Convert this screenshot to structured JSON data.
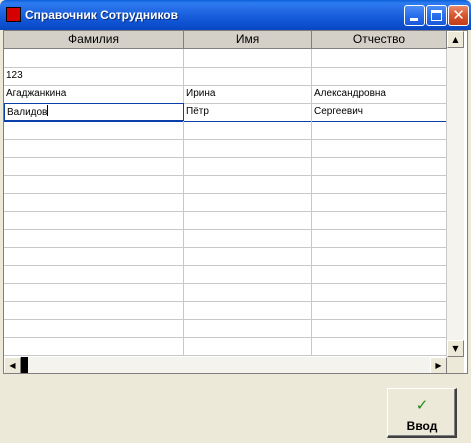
{
  "window": {
    "title": "Справочник Сотрудников",
    "close_glyph": "✕"
  },
  "grid": {
    "columns": [
      "Фамилия",
      "Имя",
      "Отчество"
    ],
    "rows": [
      [
        "",
        "",
        ""
      ],
      [
        "123",
        "",
        ""
      ],
      [
        "Агаджанкина",
        "Ирина",
        "Александровна"
      ],
      [
        "Валидов",
        "Пётр",
        "Сергеевич"
      ],
      [
        "",
        "",
        ""
      ],
      [
        "",
        "",
        ""
      ],
      [
        "",
        "",
        ""
      ],
      [
        "",
        "",
        ""
      ],
      [
        "",
        "",
        ""
      ],
      [
        "",
        "",
        ""
      ],
      [
        "",
        "",
        ""
      ],
      [
        "",
        "",
        ""
      ],
      [
        "",
        "",
        ""
      ],
      [
        "",
        "",
        ""
      ],
      [
        "",
        "",
        ""
      ],
      [
        "",
        "",
        ""
      ],
      [
        "",
        "",
        ""
      ]
    ],
    "active_row": 3
  },
  "scrollbar": {
    "up_glyph": "▲",
    "down_glyph": "▼",
    "left_glyph": "◀",
    "right_glyph": "▶"
  },
  "enter_button": {
    "label": "Ввод",
    "icon_glyph": "✓",
    "icon_color": "#1F8A1F"
  },
  "icons": {
    "app": "app-icon",
    "minimize": "minimize-icon",
    "maximize": "maximize-icon",
    "close": "close-icon",
    "check": "check-icon"
  }
}
